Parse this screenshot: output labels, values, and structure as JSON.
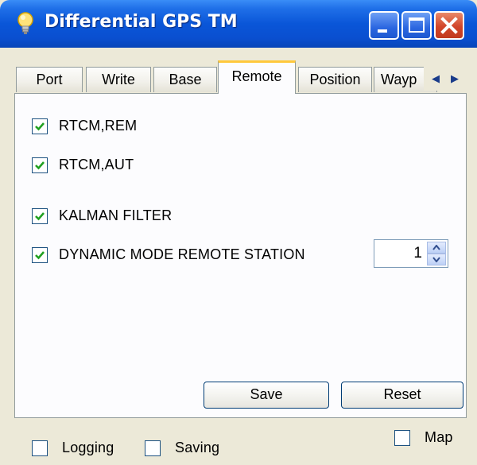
{
  "window": {
    "title": "Differential GPS TM",
    "controls": {
      "minimize_icon": "minimize-icon",
      "maximize_icon": "maximize-icon",
      "close_icon": "close-icon"
    },
    "app_icon": "lightbulb-icon"
  },
  "tabs": [
    {
      "label": "Port",
      "active": false
    },
    {
      "label": "Write",
      "active": false
    },
    {
      "label": "Base",
      "active": false
    },
    {
      "label": "Remote",
      "active": true
    },
    {
      "label": "Position",
      "active": false
    },
    {
      "label": "Wayp",
      "active": false
    }
  ],
  "tab_scroll": {
    "left_icon": "chevron-left-icon",
    "right_icon": "chevron-right-icon"
  },
  "remote": {
    "options": [
      {
        "label": "RTCM,REM",
        "checked": true
      },
      {
        "label": "RTCM,AUT",
        "checked": true
      },
      {
        "label": "KALMAN FILTER",
        "checked": true
      },
      {
        "label": "DYNAMIC MODE REMOTE STATION",
        "checked": true
      }
    ],
    "dynamic_mode_value": "1",
    "save_label": "Save",
    "reset_label": "Reset"
  },
  "footer": {
    "logging": {
      "label": "Logging",
      "checked": false
    },
    "saving": {
      "label": "Saving",
      "checked": false
    },
    "map": {
      "label": "Map",
      "checked": false
    }
  },
  "colors": {
    "title_bar": "#0a56d8",
    "tab_highlight": "#ffc83c",
    "check_green": "#21a121",
    "window_bg": "#ece9d8"
  }
}
